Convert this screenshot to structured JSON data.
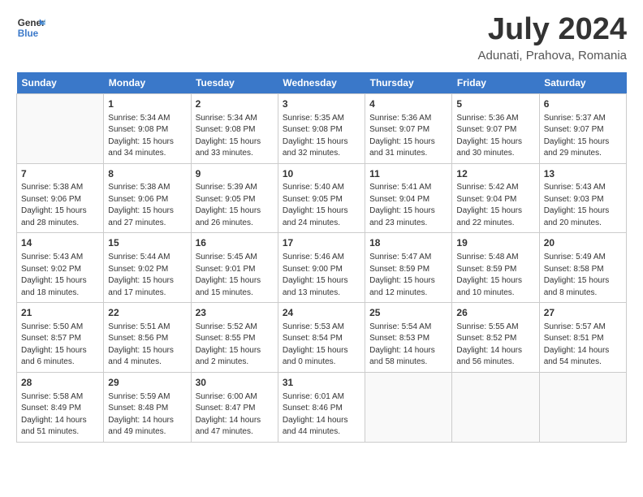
{
  "header": {
    "logo_line1": "General",
    "logo_line2": "Blue",
    "month": "July 2024",
    "location": "Adunati, Prahova, Romania"
  },
  "calendar": {
    "days_of_week": [
      "Sunday",
      "Monday",
      "Tuesday",
      "Wednesday",
      "Thursday",
      "Friday",
      "Saturday"
    ],
    "weeks": [
      [
        {
          "day": "",
          "info": ""
        },
        {
          "day": "1",
          "info": "Sunrise: 5:34 AM\nSunset: 9:08 PM\nDaylight: 15 hours\nand 34 minutes."
        },
        {
          "day": "2",
          "info": "Sunrise: 5:34 AM\nSunset: 9:08 PM\nDaylight: 15 hours\nand 33 minutes."
        },
        {
          "day": "3",
          "info": "Sunrise: 5:35 AM\nSunset: 9:08 PM\nDaylight: 15 hours\nand 32 minutes."
        },
        {
          "day": "4",
          "info": "Sunrise: 5:36 AM\nSunset: 9:07 PM\nDaylight: 15 hours\nand 31 minutes."
        },
        {
          "day": "5",
          "info": "Sunrise: 5:36 AM\nSunset: 9:07 PM\nDaylight: 15 hours\nand 30 minutes."
        },
        {
          "day": "6",
          "info": "Sunrise: 5:37 AM\nSunset: 9:07 PM\nDaylight: 15 hours\nand 29 minutes."
        }
      ],
      [
        {
          "day": "7",
          "info": "Sunrise: 5:38 AM\nSunset: 9:06 PM\nDaylight: 15 hours\nand 28 minutes."
        },
        {
          "day": "8",
          "info": "Sunrise: 5:38 AM\nSunset: 9:06 PM\nDaylight: 15 hours\nand 27 minutes."
        },
        {
          "day": "9",
          "info": "Sunrise: 5:39 AM\nSunset: 9:05 PM\nDaylight: 15 hours\nand 26 minutes."
        },
        {
          "day": "10",
          "info": "Sunrise: 5:40 AM\nSunset: 9:05 PM\nDaylight: 15 hours\nand 24 minutes."
        },
        {
          "day": "11",
          "info": "Sunrise: 5:41 AM\nSunset: 9:04 PM\nDaylight: 15 hours\nand 23 minutes."
        },
        {
          "day": "12",
          "info": "Sunrise: 5:42 AM\nSunset: 9:04 PM\nDaylight: 15 hours\nand 22 minutes."
        },
        {
          "day": "13",
          "info": "Sunrise: 5:43 AM\nSunset: 9:03 PM\nDaylight: 15 hours\nand 20 minutes."
        }
      ],
      [
        {
          "day": "14",
          "info": "Sunrise: 5:43 AM\nSunset: 9:02 PM\nDaylight: 15 hours\nand 18 minutes."
        },
        {
          "day": "15",
          "info": "Sunrise: 5:44 AM\nSunset: 9:02 PM\nDaylight: 15 hours\nand 17 minutes."
        },
        {
          "day": "16",
          "info": "Sunrise: 5:45 AM\nSunset: 9:01 PM\nDaylight: 15 hours\nand 15 minutes."
        },
        {
          "day": "17",
          "info": "Sunrise: 5:46 AM\nSunset: 9:00 PM\nDaylight: 15 hours\nand 13 minutes."
        },
        {
          "day": "18",
          "info": "Sunrise: 5:47 AM\nSunset: 8:59 PM\nDaylight: 15 hours\nand 12 minutes."
        },
        {
          "day": "19",
          "info": "Sunrise: 5:48 AM\nSunset: 8:59 PM\nDaylight: 15 hours\nand 10 minutes."
        },
        {
          "day": "20",
          "info": "Sunrise: 5:49 AM\nSunset: 8:58 PM\nDaylight: 15 hours\nand 8 minutes."
        }
      ],
      [
        {
          "day": "21",
          "info": "Sunrise: 5:50 AM\nSunset: 8:57 PM\nDaylight: 15 hours\nand 6 minutes."
        },
        {
          "day": "22",
          "info": "Sunrise: 5:51 AM\nSunset: 8:56 PM\nDaylight: 15 hours\nand 4 minutes."
        },
        {
          "day": "23",
          "info": "Sunrise: 5:52 AM\nSunset: 8:55 PM\nDaylight: 15 hours\nand 2 minutes."
        },
        {
          "day": "24",
          "info": "Sunrise: 5:53 AM\nSunset: 8:54 PM\nDaylight: 15 hours\nand 0 minutes."
        },
        {
          "day": "25",
          "info": "Sunrise: 5:54 AM\nSunset: 8:53 PM\nDaylight: 14 hours\nand 58 minutes."
        },
        {
          "day": "26",
          "info": "Sunrise: 5:55 AM\nSunset: 8:52 PM\nDaylight: 14 hours\nand 56 minutes."
        },
        {
          "day": "27",
          "info": "Sunrise: 5:57 AM\nSunset: 8:51 PM\nDaylight: 14 hours\nand 54 minutes."
        }
      ],
      [
        {
          "day": "28",
          "info": "Sunrise: 5:58 AM\nSunset: 8:49 PM\nDaylight: 14 hours\nand 51 minutes."
        },
        {
          "day": "29",
          "info": "Sunrise: 5:59 AM\nSunset: 8:48 PM\nDaylight: 14 hours\nand 49 minutes."
        },
        {
          "day": "30",
          "info": "Sunrise: 6:00 AM\nSunset: 8:47 PM\nDaylight: 14 hours\nand 47 minutes."
        },
        {
          "day": "31",
          "info": "Sunrise: 6:01 AM\nSunset: 8:46 PM\nDaylight: 14 hours\nand 44 minutes."
        },
        {
          "day": "",
          "info": ""
        },
        {
          "day": "",
          "info": ""
        },
        {
          "day": "",
          "info": ""
        }
      ]
    ]
  }
}
